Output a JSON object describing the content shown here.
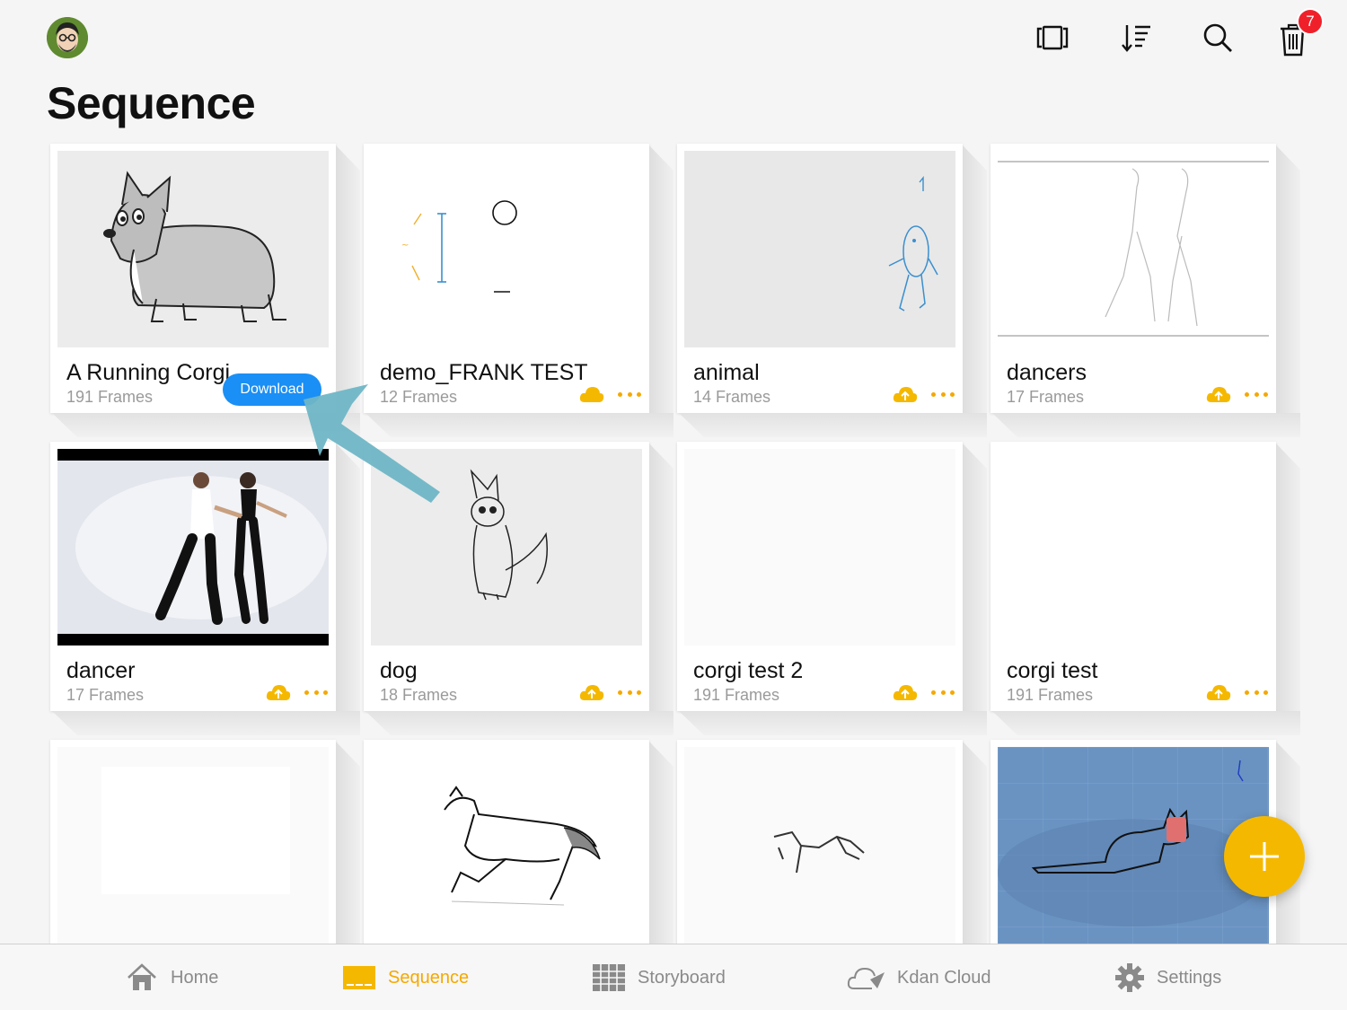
{
  "header": {
    "title": "Sequence",
    "trash_badge": "7"
  },
  "download_label": "Download",
  "cards": [
    {
      "title": "A Running Corgi",
      "frames": "191 Frames"
    },
    {
      "title": "demo_FRANK TEST",
      "frames": "12 Frames"
    },
    {
      "title": "animal",
      "frames": "14 Frames"
    },
    {
      "title": "dancers",
      "frames": "17 Frames"
    },
    {
      "title": "dancer",
      "frames": "17 Frames"
    },
    {
      "title": "dog",
      "frames": "18 Frames"
    },
    {
      "title": "corgi test 2",
      "frames": "191 Frames"
    },
    {
      "title": "corgi test",
      "frames": "191 Frames"
    }
  ],
  "tabs": [
    {
      "label": "Home"
    },
    {
      "label": "Sequence"
    },
    {
      "label": "Storyboard"
    },
    {
      "label": "Kdan Cloud"
    },
    {
      "label": "Settings"
    }
  ],
  "colors": {
    "accent": "#f5a800",
    "download": "#1a8ff5",
    "badge": "#f0202a",
    "arrow": "#6fb6c6"
  }
}
